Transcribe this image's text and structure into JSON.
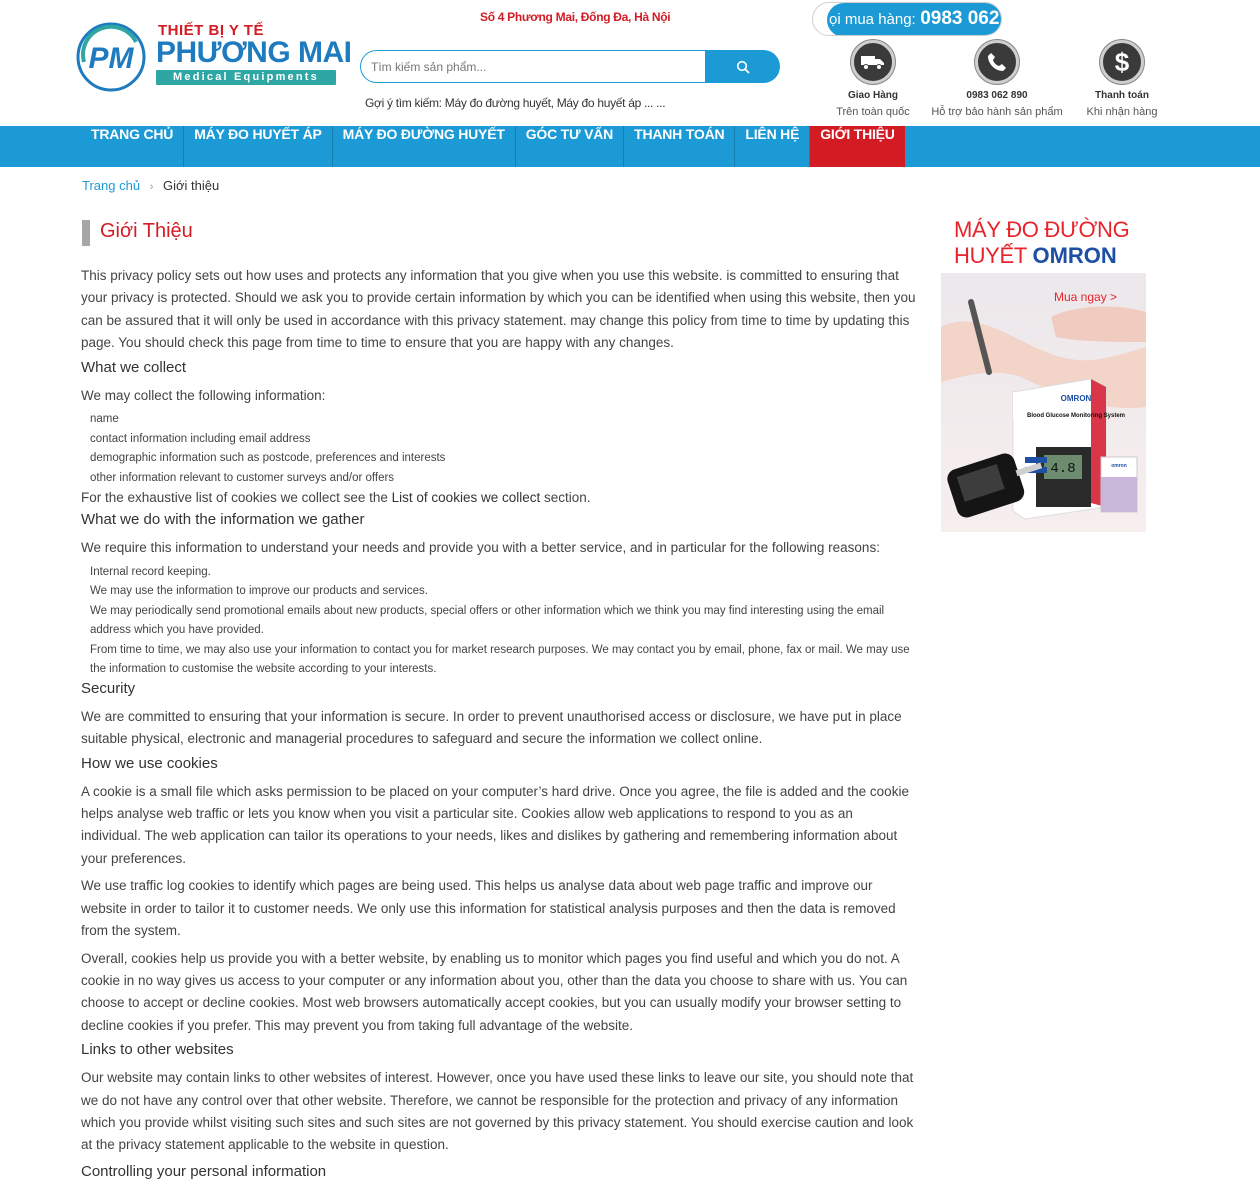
{
  "header": {
    "logo": {
      "top_text": "THIẾT BỊ Y TẾ",
      "brand": "PHƯƠNG MAI",
      "sub": "Medical Equipments",
      "mark": "PM"
    },
    "address": "Số 4 Phương Mai, Đống Đa, Hà Nội",
    "search": {
      "placeholder": "Tìm kiếm sản phẩm...",
      "button_icon": "search-icon",
      "suggest_label": "Gợi ý tìm kiếm:",
      "suggest_items": "Máy đo đường huyết, Máy đo huyết áp ... ..."
    },
    "hotline": {
      "label": "ọi mua hàng:",
      "number": "0983 062"
    },
    "services": [
      {
        "icon": "truck-icon",
        "title": "Giao Hàng",
        "subtitle": "Trên toàn quốc"
      },
      {
        "icon": "phone-icon",
        "title": "0983 062 890",
        "subtitle": "Hỗ trợ bảo hành sản phẩm"
      },
      {
        "icon": "dollar-icon",
        "title": "Thanh toán",
        "subtitle": "Khi nhận hàng"
      }
    ]
  },
  "nav": {
    "items": [
      {
        "label": "TRANG CHỦ"
      },
      {
        "label": "MÁY ĐO HUYẾT ÁP"
      },
      {
        "label": "MÁY ĐO ĐƯỜNG HUYẾT"
      },
      {
        "label": "GÓC TƯ VẤN"
      },
      {
        "label": "THANH TOÁN"
      },
      {
        "label": "LIÊN HỆ"
      },
      {
        "label": "GIỚI THIỆU"
      }
    ],
    "active_index": 6
  },
  "breadcrumb": {
    "home": "Trang chủ",
    "separator": "›",
    "current": "Giới thiệu"
  },
  "article": {
    "title": "Giới Thiệu",
    "intro": "This privacy policy sets out how uses and protects any information that you give when you use this website. is committed to ensuring that your privacy is protected. Should we ask you to provide certain information by which you can be identified when using this website, then you can be assured that it will only be used in accordance with this privacy statement. may change this policy from time to time by updating this page. You should check this page from time to time to ensure that you are happy with any changes.",
    "collect": {
      "heading": "What we collect",
      "lead": "We may collect the following information:",
      "items": [
        "name",
        "contact information including email address",
        "demographic information such as postcode, preferences and interests",
        "other information relevant to customer surveys and/or offers"
      ],
      "after_prefix": "For the exhaustive list of cookies we collect see the ",
      "after_link": "List of cookies we collect",
      "after_suffix": " section."
    },
    "gather": {
      "heading": "What we do with the information we gather",
      "lead": "We require this information to understand your needs and provide you with a better service, and in particular for the following reasons:",
      "items": [
        "Internal record keeping.",
        "We may use the information to improve our products and services.",
        "We may periodically send promotional emails about new products, special offers or other information which we think you may find interesting using the email address which you have provided.",
        "From time to time, we may also use your information to contact you for market research purposes. We may contact you by email, phone, fax or mail. We may use the information to customise the website according to your interests."
      ]
    },
    "security": {
      "heading": "Security",
      "text": "We are committed to ensuring that your information is secure. In order to prevent unauthorised access or disclosure, we have put in place suitable physical, electronic and managerial procedures to safeguard and secure the information we collect online."
    },
    "cookies": {
      "heading": "How we use cookies",
      "p1": "A cookie is a small file which asks permission to be placed on your computer’s hard drive. Once you agree, the file is added and the cookie helps analyse web traffic or lets you know when you visit a particular site. Cookies allow web applications to respond to you as an individual. The web application can tailor its operations to your needs, likes and dislikes by gathering and remembering information about your preferences.",
      "p2": "We use traffic log cookies to identify which pages are being used. This helps us analyse data about web page traffic and improve our website in order to tailor it to customer needs. We only use this information for statistical analysis purposes and then the data is removed from the system.",
      "p3": "Overall, cookies help us provide you with a better website, by enabling us to monitor which pages you find useful and which you do not. A cookie in no way gives us access to your computer or any information about you, other than the data you choose to share with us. You can choose to accept or decline cookies. Most web browsers automatically accept cookies, but you can usually modify your browser setting to decline cookies if you prefer. This may prevent you from taking full advantage of the website."
    },
    "links": {
      "heading": "Links to other websites",
      "text": "Our website may contain links to other websites of interest. However, once you have used these links to leave our site, you should note that we do not have any control over that other website. Therefore, we cannot be responsible for the protection and privacy of any information which you provide whilst visiting such sites and such sites are not governed by this privacy statement. You should exercise caution and look at the privacy statement applicable to the website in question."
    },
    "controlling": {
      "heading": "Controlling your personal information"
    }
  },
  "banner": {
    "line1": "MÁY ĐO ĐƯỜNG",
    "line2": "HUYẾT",
    "brand": "OMRON",
    "cta": "Mua ngay >",
    "box_brand": "OMRON",
    "box_title": "Blood Glucose Monitoring System",
    "meter_reading": "4.8",
    "strip_brand": "omron"
  },
  "colors": {
    "primary_blue": "#1c9ad6",
    "accent_red": "#d31b24",
    "teal": "#2ea6a3"
  }
}
